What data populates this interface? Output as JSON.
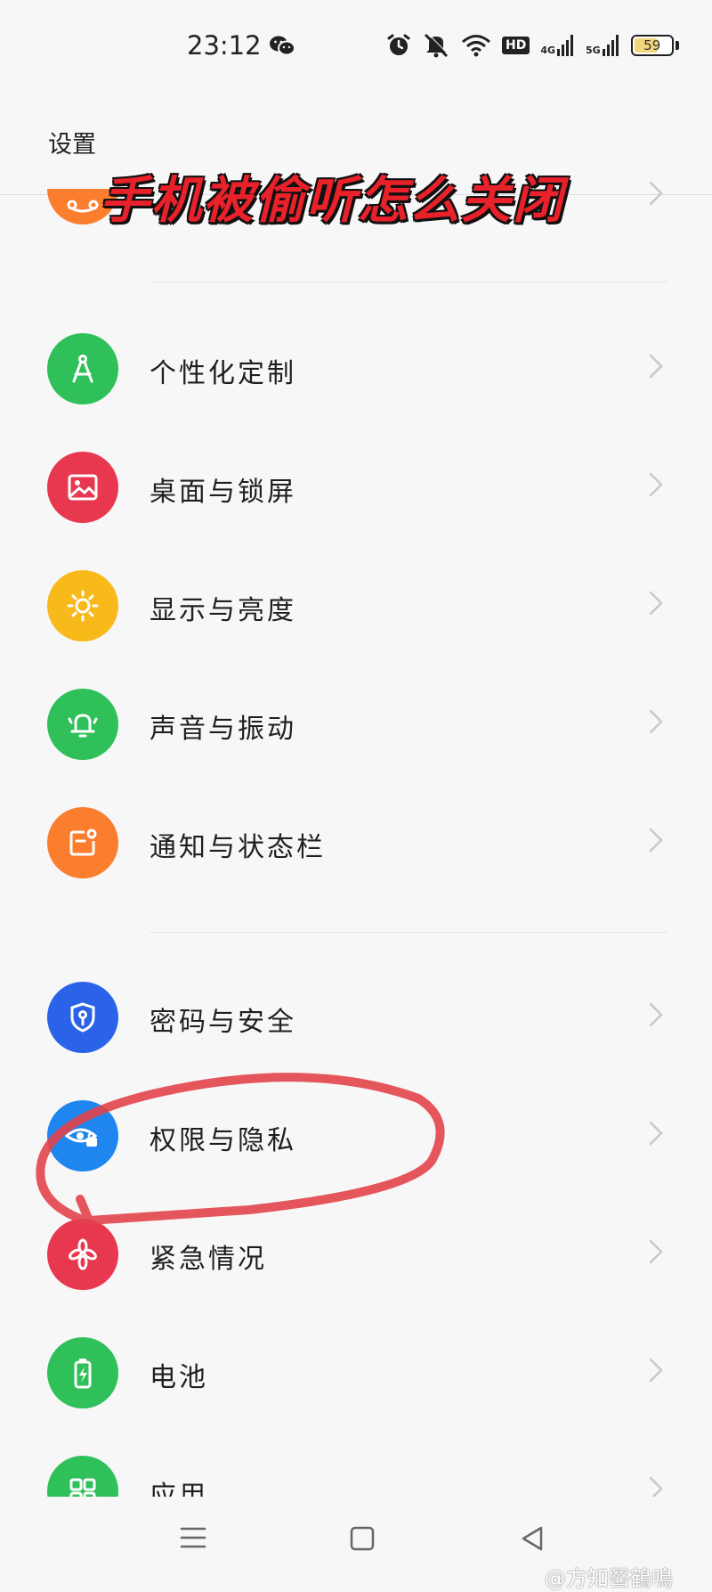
{
  "status_bar": {
    "time": "23:12",
    "network_4g": "4G",
    "network_5g": "5G",
    "hd_label": "HD",
    "battery": "59"
  },
  "header": {
    "title": "设置"
  },
  "overlay": {
    "title": "手机被偷听怎么关闭"
  },
  "settings_groups": [
    {
      "items": [
        {
          "label": "个性化定制",
          "icon": "compass-icon",
          "color": "#2fc05a"
        },
        {
          "label": "桌面与锁屏",
          "icon": "image-icon",
          "color": "#e8384f"
        },
        {
          "label": "显示与亮度",
          "icon": "sun-icon",
          "color": "#f8b91b"
        },
        {
          "label": "声音与振动",
          "icon": "bell-icon",
          "color": "#2fc05a"
        },
        {
          "label": "通知与状态栏",
          "icon": "notification-icon",
          "color": "#fb7d2e"
        }
      ]
    },
    {
      "items": [
        {
          "label": "密码与安全",
          "icon": "shield-key-icon",
          "color": "#2a63e8"
        },
        {
          "label": "权限与隐私",
          "icon": "eye-lock-icon",
          "color": "#1f86f0"
        },
        {
          "label": "紧急情况",
          "icon": "asterisk-icon",
          "color": "#e8384f"
        },
        {
          "label": "电池",
          "icon": "battery-icon",
          "color": "#2fc05a"
        },
        {
          "label": "应用",
          "icon": "apps-icon",
          "color": "#2fc05a"
        }
      ]
    }
  ],
  "watermark": "@方知醫鶴鳴",
  "colors": {
    "annotation_circle": "#e2434a",
    "overlay_text": "#e8212a",
    "top_partial_icon": "#fb7d2e"
  }
}
